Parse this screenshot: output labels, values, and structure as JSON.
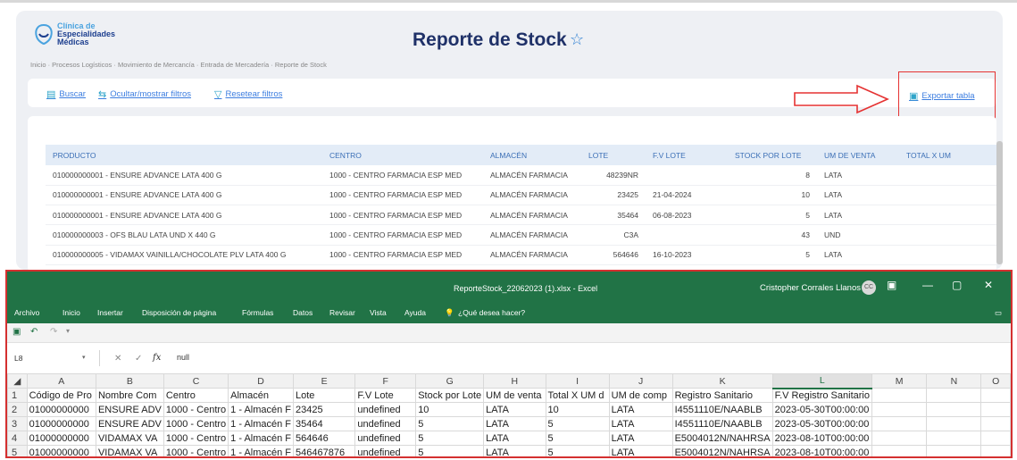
{
  "app": {
    "logo_line1": "Clínica de",
    "logo_line2": "Especialidades",
    "logo_line3": "Médicas",
    "title": "Reporte de Stock",
    "breadcrumb": "Inicio  ·  Procesos Logísticos  ·  Movimiento de Mercancía  ·  Entrada de Mercadería  ·  Reporte de Stock",
    "toolbar": {
      "search": "Buscar",
      "toggle_filters": "Ocultar/mostrar filtros",
      "reset_filters": "Resetear filtros",
      "export": "Exportar tabla"
    },
    "table": {
      "columns": [
        "PRODUCTO",
        "CENTRO",
        "ALMACÉN",
        "LOTE",
        "F.V LOTE",
        "STOCK POR LOTE",
        "UM DE VENTA",
        "TOTAL X UM"
      ],
      "rows": [
        [
          "010000000001 - ENSURE ADVANCE LATA 400 G",
          "1000 - CENTRO FARMACIA ESP MED",
          "ALMACÉN FARMACIA",
          "48239NR",
          "",
          "8",
          "LATA",
          ""
        ],
        [
          "010000000001 - ENSURE ADVANCE LATA 400 G",
          "1000 - CENTRO FARMACIA ESP MED",
          "ALMACÉN FARMACIA",
          "23425",
          "21-04-2024",
          "10",
          "LATA",
          ""
        ],
        [
          "010000000001 - ENSURE ADVANCE LATA 400 G",
          "1000 - CENTRO FARMACIA ESP MED",
          "ALMACÉN FARMACIA",
          "35464",
          "06-08-2023",
          "5",
          "LATA",
          ""
        ],
        [
          "010000000003 - OFS BLAU LATA UND X 440 G",
          "1000 - CENTRO FARMACIA ESP MED",
          "ALMACÉN FARMACIA",
          "C3A",
          "",
          "43",
          "UND",
          ""
        ],
        [
          "010000000005 - VIDAMAX VAINILLA/CHOCOLATE PLV LATA 400 G",
          "1000 - CENTRO FARMACIA ESP MED",
          "ALMACÉN FARMACIA",
          "564646",
          "16-10-2023",
          "5",
          "LATA",
          ""
        ]
      ]
    }
  },
  "excel": {
    "filename": "ReporteStock_22062023 (1).xlsx  -  Excel",
    "user": "Cristopher Corrales Llanos",
    "user_initials": "CC",
    "ribbon": [
      "Archivo",
      "Inicio",
      "Insertar",
      "Disposición de página",
      "Fórmulas",
      "Datos",
      "Revisar",
      "Vista",
      "Ayuda"
    ],
    "tell_me": "¿Qué desea hacer?",
    "name_box": "L8",
    "formula": "null",
    "columns": [
      "A",
      "B",
      "C",
      "D",
      "E",
      "F",
      "G",
      "H",
      "I",
      "J",
      "K",
      "L",
      "M",
      "N",
      "O"
    ],
    "rows": [
      [
        "1",
        "Código de Pro",
        "Nombre Com",
        "Centro",
        "Almacén",
        "Lote",
        "F.V Lote",
        "Stock por Lote",
        "UM de venta",
        "Total X UM d",
        "UM de comp",
        "Registro Sanitario",
        "F.V Registro Sanitario",
        "",
        "",
        ""
      ],
      [
        "2",
        "01000000000",
        "ENSURE ADV",
        "1000 - Centro",
        "1 - Almacén F",
        "23425",
        "undefined",
        "10",
        "LATA",
        "10",
        "LATA",
        "I4551110E/NAABLB",
        "2023-05-30T00:00:00",
        "",
        "",
        ""
      ],
      [
        "3",
        "01000000000",
        "ENSURE ADV",
        "1000 - Centro",
        "1 - Almacén F",
        "35464",
        "undefined",
        "5",
        "LATA",
        "5",
        "LATA",
        "I4551110E/NAABLB",
        "2023-05-30T00:00:00",
        "",
        "",
        ""
      ],
      [
        "4",
        "01000000000",
        "VIDAMAX VA",
        "1000 - Centro",
        "1 - Almacén F",
        "564646",
        "undefined",
        "5",
        "LATA",
        "5",
        "LATA",
        "E5004012N/NAHRSA",
        "2023-08-10T00:00:00",
        "",
        "",
        ""
      ],
      [
        "5",
        "01000000000",
        "VIDAMAX VA",
        "1000 - Centro",
        "1 - Almacén F",
        "546467876",
        "undefined",
        "5",
        "LATA",
        "5",
        "LATA",
        "E5004012N/NAHRSA",
        "2023-08-10T00:00:00",
        "",
        "",
        ""
      ]
    ]
  },
  "colors": {
    "excel_green": "#217346",
    "accent_blue": "#3d7ee0",
    "title_navy": "#1f3168",
    "highlight_red": "#e53232"
  }
}
